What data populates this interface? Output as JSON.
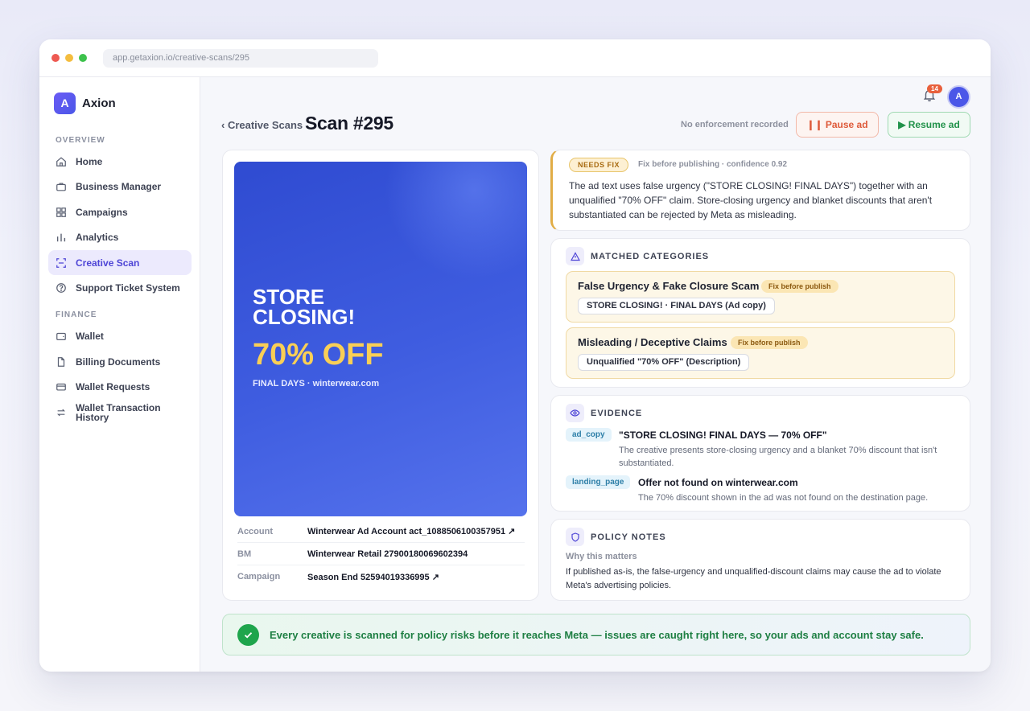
{
  "browser": {
    "url": "app.getaxion.io/creative-scans/295"
  },
  "brand": {
    "logo_letter": "A",
    "name": "Axion"
  },
  "sidebar": {
    "overview_label": "OVERVIEW",
    "finance_label": "FINANCE",
    "overview_items": [
      {
        "label": "Home",
        "icon": "home-icon"
      },
      {
        "label": "Business Manager",
        "icon": "briefcase-icon"
      },
      {
        "label": "Campaigns",
        "icon": "grid-icon"
      },
      {
        "label": "Analytics",
        "icon": "bar-chart-icon"
      },
      {
        "label": "Creative Scan",
        "icon": "scan-icon",
        "active": true
      },
      {
        "label": "Support Ticket System",
        "icon": "help-circle-icon"
      }
    ],
    "finance_items": [
      {
        "label": "Wallet",
        "icon": "wallet-icon"
      },
      {
        "label": "Billing Documents",
        "icon": "document-icon"
      },
      {
        "label": "Wallet Requests",
        "icon": "credit-card-icon"
      },
      {
        "label": "Wallet Transaction History",
        "icon": "transfer-icon"
      }
    ]
  },
  "topbar": {
    "notification_count": "14",
    "avatar_letter": "A"
  },
  "header": {
    "back_label": "‹ Creative Scans",
    "title": "Scan #295",
    "enforcement_status": "No enforcement recorded",
    "pause_label": "❙❙ Pause ad",
    "resume_label": "▶ Resume ad"
  },
  "creative": {
    "headline": "STORE CLOSING!",
    "offer": "70% OFF",
    "subline": "FINAL DAYS · winterwear.com"
  },
  "meta": [
    {
      "key": "Account",
      "value": "Winterwear Ad Account act_1088506100357951 ↗"
    },
    {
      "key": "BM",
      "value": "Winterwear Retail 27900180069602394"
    },
    {
      "key": "Campaign",
      "value": "Season End 52594019336995 ↗"
    }
  ],
  "verdict": {
    "status": "NEEDS FIX",
    "subtitle": "Fix before publishing · confidence 0.92",
    "text": "The ad text uses false urgency (\"STORE CLOSING! FINAL DAYS\") together with an unqualified \"70% OFF\" claim. Store-closing urgency and blanket discounts that aren't substantiated can be rejected by Meta as misleading."
  },
  "categories": {
    "heading": "MATCHED CATEGORIES",
    "items": [
      {
        "title": "False Urgency & Fake Closure Scam",
        "severity": "Fix before publish",
        "tag": "STORE CLOSING! · FINAL DAYS (Ad copy)"
      },
      {
        "title": "Misleading / Deceptive Claims",
        "severity": "Fix before publish",
        "tag": "Unqualified \"70% OFF\" (Description)"
      }
    ]
  },
  "evidence": {
    "heading": "EVIDENCE",
    "items": [
      {
        "source": "ad_copy",
        "title": "\"STORE CLOSING! FINAL DAYS — 70% OFF\"",
        "text": "The creative presents store-closing urgency and a blanket 70% discount that isn't substantiated."
      },
      {
        "source": "landing_page",
        "title": "Offer not found on winterwear.com",
        "text": "The 70% discount shown in the ad was not found on the destination page."
      }
    ]
  },
  "policy": {
    "heading": "POLICY NOTES",
    "why_label": "Why this matters",
    "text": "If published as-is, the false-urgency and unqualified-discount claims may cause the ad to violate Meta's advertising policies."
  },
  "banner": {
    "text": "Every creative is scanned for policy risks before it reaches Meta — issues are caught right here, so your ads and account stay safe."
  },
  "colors": {
    "accent": "#4e45d6",
    "warning": "#e1ad46",
    "danger": "#de5a3a",
    "success": "#21924a"
  }
}
